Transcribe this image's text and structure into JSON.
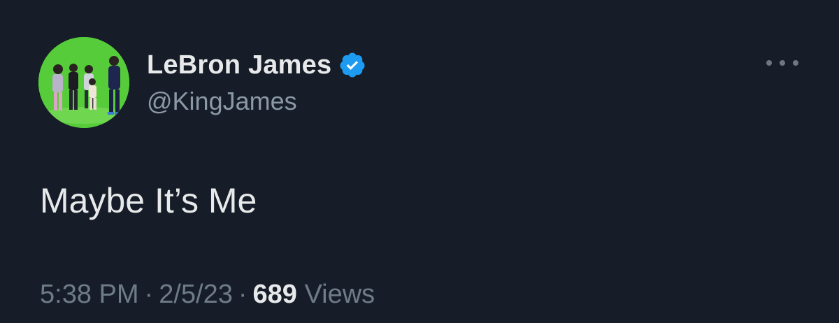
{
  "author": {
    "display_name": "LeBron James",
    "handle": "@KingJames",
    "verified": true,
    "avatar_icon": "avatar-photo-icon",
    "verified_icon": "verified-badge-icon"
  },
  "tweet": {
    "text": "Maybe It’s Me"
  },
  "meta": {
    "time": "5:38 PM",
    "separator": "·",
    "date": "2/5/23",
    "views_count": "689",
    "views_label": "Views"
  },
  "menu": {
    "icon": "more-options-icon"
  },
  "colors": {
    "background": "#161d28",
    "primary_text": "#e7e9ea",
    "secondary_text": "#8b98a5",
    "verified_blue": "#1d9bf0",
    "avatar_green": "#57cc3a"
  }
}
